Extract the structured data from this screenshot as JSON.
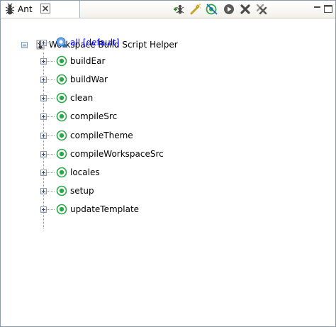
{
  "tab": {
    "label": "Ant",
    "close_icon": "close-x-icon",
    "icon": "ant-icon"
  },
  "toolbar": {
    "buttons": [
      {
        "name": "add-buildfiles-button",
        "icon": "add-ant-icon"
      },
      {
        "name": "add-buildfiles-search-button",
        "icon": "wand-icon"
      },
      {
        "name": "hide-internal-targets-button",
        "icon": "filter-target-icon"
      },
      {
        "name": "run-target-button",
        "icon": "run-icon"
      },
      {
        "name": "remove-button",
        "icon": "remove-icon"
      },
      {
        "name": "remove-all-button",
        "icon": "remove-all-icon"
      },
      {
        "name": "minimize-button",
        "icon": "minimize-icon"
      },
      {
        "name": "maximize-button",
        "icon": "maximize-icon"
      }
    ]
  },
  "tree": {
    "root": {
      "label": "Workspace Build Script Helper",
      "expanded": true,
      "icon": "ant-buildfile-icon"
    },
    "targets": [
      {
        "label": "all [default]",
        "default": true,
        "icon": "default-target-icon"
      },
      {
        "label": "buildEar",
        "default": false,
        "icon": "target-icon"
      },
      {
        "label": "buildWar",
        "default": false,
        "icon": "target-icon"
      },
      {
        "label": "clean",
        "default": false,
        "icon": "target-icon"
      },
      {
        "label": "compileSrc",
        "default": false,
        "icon": "target-icon"
      },
      {
        "label": "compileTheme",
        "default": false,
        "icon": "target-icon"
      },
      {
        "label": "compileWorkspaceSrc",
        "default": false,
        "icon": "target-icon"
      },
      {
        "label": "locales",
        "default": false,
        "icon": "target-icon"
      },
      {
        "label": "setup",
        "default": false,
        "icon": "target-icon"
      },
      {
        "label": "updateTemplate",
        "default": false,
        "icon": "target-icon"
      }
    ]
  },
  "colors": {
    "default_target_text": "#0000ff",
    "target_green": "#2aa84a",
    "border": "#8c9aa8"
  }
}
